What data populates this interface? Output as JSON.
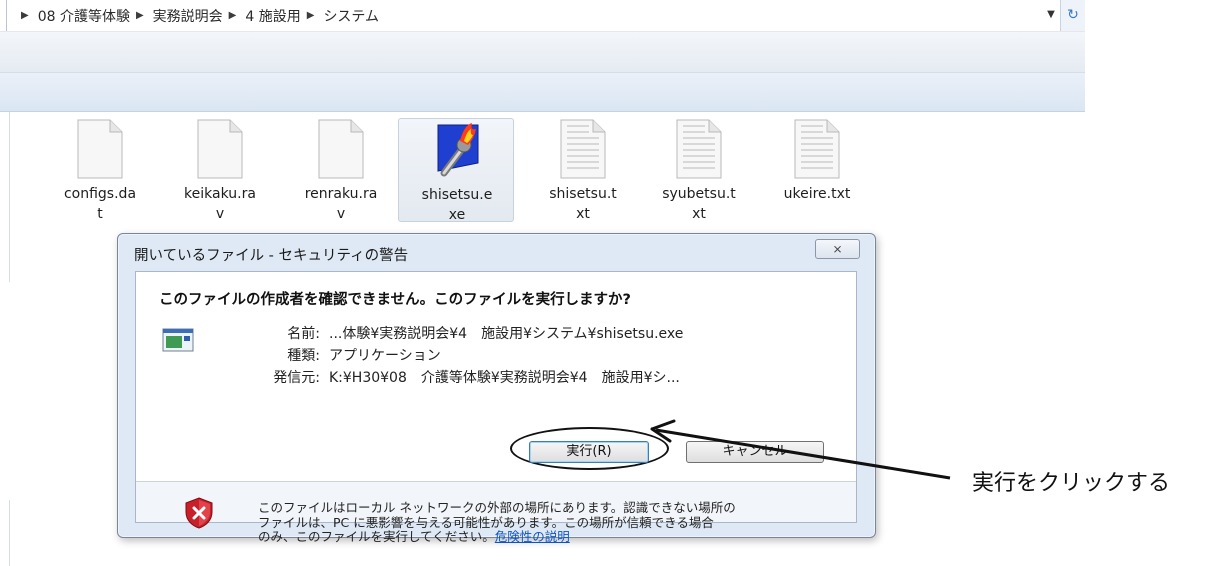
{
  "breadcrumb": [
    "08 介護等体験",
    "実務説明会",
    "4 施設用",
    "システム"
  ],
  "files": [
    {
      "name": "configs.dat",
      "label_lines": [
        "configs.da",
        "t"
      ],
      "type": "blank"
    },
    {
      "name": "keikaku.rav",
      "label_lines": [
        "keikaku.ra",
        "v"
      ],
      "type": "blank"
    },
    {
      "name": "renraku.rav",
      "label_lines": [
        "renraku.ra",
        "v"
      ],
      "type": "blank"
    },
    {
      "name": "shisetsu.exe",
      "label_lines": [
        "shisetsu.e",
        "xe"
      ],
      "type": "exe",
      "selected": true
    },
    {
      "name": "shisetsu.txt",
      "label_lines": [
        "shisetsu.t",
        "xt"
      ],
      "type": "text"
    },
    {
      "name": "syubetsu.txt",
      "label_lines": [
        "syubetsu.t",
        "xt"
      ],
      "type": "text"
    },
    {
      "name": "ukeire.txt",
      "label_lines": [
        "ukeire.txt",
        ""
      ],
      "type": "text"
    }
  ],
  "dialog": {
    "title": "開いているファイル - セキュリティの警告",
    "close_symbol": "⨯",
    "question": "このファイルの作成者を確認できません。このファイルを実行しますか?",
    "name_label": "名前:",
    "name_value": "...体験¥実務説明会¥4　施設用¥システム¥shisetsu.exe",
    "type_label": "種類:",
    "type_value": "アプリケーション",
    "from_label": "発信元:",
    "from_value": "K:¥H30¥08　介護等体験¥実務説明会¥4　施設用¥シ...",
    "run_button": "実行(R)",
    "cancel_button": "キャンセル",
    "warning_line1": "このファイルはローカル ネットワークの外部の場所にあります。認識できない場所の",
    "warning_line2": "ファイルは、PC に悪影響を与える可能性があります。この場所が信頼できる場合",
    "warning_line3": "のみ、このファイルを実行してください。",
    "risk_link": "危険性の説明"
  },
  "annotation": {
    "text": "実行をクリックする"
  },
  "colors": {
    "dialog_frame": "#dfe9f5",
    "link": "#0b55c8",
    "shield_red": "#c8202a"
  }
}
